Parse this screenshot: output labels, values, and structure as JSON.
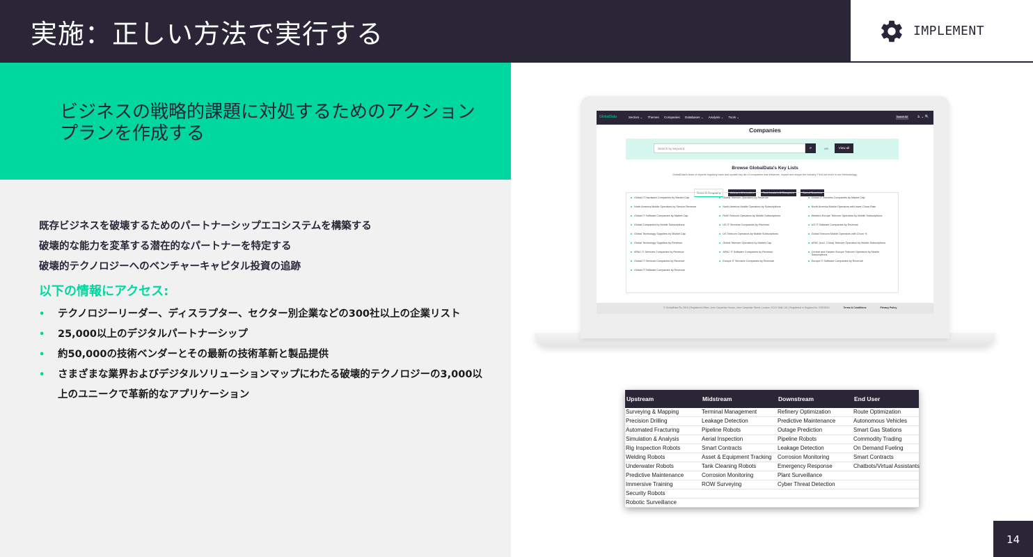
{
  "header": {
    "title": "実施：正しい方法で実行する",
    "tag_icon": "gear-icon",
    "tag_label": "IMPLEMENT"
  },
  "subtitle": "ビジネスの戦略的課題に対処するためのアクションプランを作成する",
  "plain_items": [
    "既存ビジネスを破壊するためのパートナーシップエコシステムを構築する",
    "破壊的な能力を変革する潜在的なパートナーを特定する",
    "破壊的テクノロジーへのベンチャーキャピタル投資の追跡"
  ],
  "access_heading": "以下の情報にアクセス:",
  "bullets": [
    "テクノロジーリーダー、ディスラプター、セクター別企業などの300社以上の企業リスト",
    "25,000以上のデジタルパートナーシップ",
    "約50,000の技術ベンダーとその最新の技術革新と製品提供",
    "さまざまな業界およびデジタルソリューションマップにわたる破壊的テクノロジーの3,000以上のユニークで革新的なアプリケーション"
  ],
  "screenshot": {
    "logo": "GlobalData",
    "nav": [
      "Sectors ⌄",
      "Themes",
      "Companies",
      "Databases ⌄",
      "Analysis ⌄",
      "Tools ⌄"
    ],
    "nav_search": "Search All",
    "nav_icons": "♙ ⌄ 🔍",
    "title": "Companies",
    "search_placeholder": "Search by keyword",
    "or_label": "OR",
    "view_all": "View all",
    "browse_title": "Browse GlobalData's Key Lists",
    "browse_desc": "GlobalData's team of experts regularly track and update key list of companies that influence, impact and shape the industry. Find out more in our Methodology.",
    "tabs": [
      "Sector & Geography",
      "Advisors & Investors",
      "Tech Leaders & Disruptors",
      "Saved Searches"
    ],
    "lists": [
      "Global IT Hardware Companies by Market Cap",
      "Global Telecom Operators by Revenue",
      "Global IT Services Companies by Market Cap",
      "North America Mobile Operators by Service Revenue",
      "North America Mobile Operators by Subscriptions",
      "North America Mobile Operators with lower Churn Rate",
      "Global IT Software Companies by Market Cap",
      "RoW Telecom Operators by Mobile Subscriptions",
      "Western Europe Telecom Operators by Mobile Subscriptions",
      "Global Companies by Mobile Subscriptions",
      "US IT Services Companies by Revenue",
      "US IT Software Companies by Revenue",
      "Global Technology Suppliers by Market Cap",
      "US Telecom Operators by Mobile Subscriptions",
      "Global Telecom Mobile Operators with Churn %",
      "Global Technology Suppliers by Revenue",
      "Global Telecom Operators by Market Cap",
      "APAC (excl. China) Telecom Operators by Mobile Subscriptions",
      "APAC IT Services Companies by Revenue",
      "APAC IT Software Companies by Revenue",
      "Central and Eastern Europe Telecom Operators by Mobile Subscriptions",
      "Global IT Services Companies by Revenue",
      "Europe IT Services Companies by Revenue",
      "Europe IT Software Companies by Revenue",
      "Global IT Software Companies by Revenue",
      "",
      ""
    ],
    "footer_text": "© GlobalData Plc 2019 | Registered Office: John Carpenter House, John Carpenter Street, London, EC4Y 0AN, UK | Registered in England No. 03925319",
    "footer_links": [
      "Terms & Conditions",
      "Privacy Policy"
    ]
  },
  "segments": {
    "headers": [
      "Upstream",
      "Midstream",
      "Downstream",
      "End User"
    ],
    "rows": [
      [
        "Surveying & Mapping",
        "Terminal Management",
        "Refinery Optimization",
        "Route Optimization"
      ],
      [
        "Precision Drilling",
        "Leakage Detection",
        "Predictive Maintenance",
        "Autonomous Vehicles"
      ],
      [
        "Automated Fracturing",
        "Pipeline Robots",
        "Outage Prediction",
        "Smart Gas Stations"
      ],
      [
        "Simulation & Analysis",
        "Aerial Inspection",
        "Pipeline Robots",
        "Commodity Trading"
      ],
      [
        "Rig Inspection Robots",
        "Smart Contracts",
        "Leakage Detection",
        "On Demand Fueling"
      ],
      [
        "Welding Robots",
        "Asset & Equipment Tracking",
        "Corrosion Monitoring",
        "Smart Contracts"
      ],
      [
        "Underwater Robots",
        "Tank Cleaning Robots",
        "Emergency Response",
        "Chatbots/Virtual Assistants"
      ],
      [
        "Predictive Maintenance",
        "Corrosion Monitoring",
        "Plant Surveillance",
        ""
      ],
      [
        "Immersive Training",
        "ROW Surveying",
        "Cyber Threat Detection",
        ""
      ],
      [
        "Security Robots",
        "",
        "",
        ""
      ],
      [
        "Robotic Surveillance",
        "",
        "",
        ""
      ]
    ]
  },
  "page_number": "14",
  "colors": {
    "dark": "#2b2538",
    "accent": "#00d8a0",
    "panel": "#f1f1f1"
  }
}
